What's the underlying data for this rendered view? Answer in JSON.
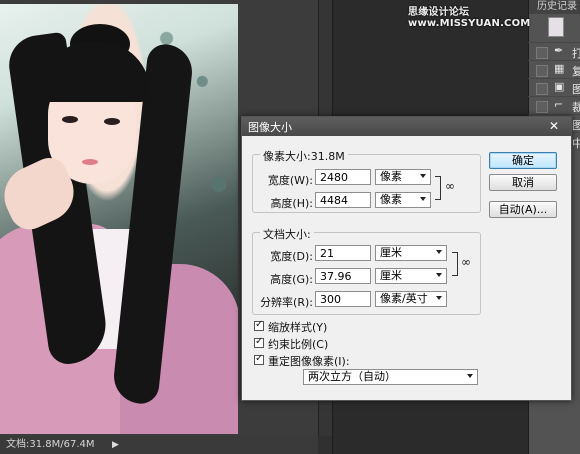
{
  "status": {
    "doc_size": "文档:31.8M/67.4M"
  },
  "watermark": "思缘设计论坛 www.MISSYUAN.COM",
  "history": {
    "title": "历史记录",
    "items": [
      {
        "icon": "brush-icon",
        "glyph": "✒",
        "label": "打"
      },
      {
        "icon": "document-icon",
        "glyph": "▦",
        "label": "复"
      },
      {
        "icon": "image-icon",
        "glyph": "▣",
        "label": "图"
      },
      {
        "icon": "crop-icon",
        "glyph": "⌐",
        "label": "裁"
      },
      {
        "icon": "image-icon",
        "glyph": "▣",
        "label": "图"
      },
      {
        "icon": "image-icon",
        "glyph": "▣",
        "label": "中"
      }
    ]
  },
  "dialog": {
    "title": "图像大小",
    "close": "✕",
    "pixel_group": {
      "title": "像素大小:31.8M",
      "width_label": "宽度(W):",
      "width_value": "2480",
      "width_unit": "像素",
      "height_label": "高度(H):",
      "height_value": "4484",
      "height_unit": "像素"
    },
    "doc_group": {
      "title": "文档大小:",
      "width_label": "宽度(D):",
      "width_value": "21",
      "width_unit": "厘米",
      "height_label": "高度(G):",
      "height_value": "37.96",
      "height_unit": "厘米",
      "res_label": "分辨率(R):",
      "res_value": "300",
      "res_unit": "像素/英寸"
    },
    "buttons": {
      "ok": "确定",
      "cancel": "取消",
      "auto": "自动(A)..."
    },
    "checkboxes": {
      "scale_styles": "缩放样式(Y)",
      "constrain": "约束比例(C)",
      "resample": "重定图像像素(I):"
    },
    "resample_method": "两次立方（自动）"
  }
}
